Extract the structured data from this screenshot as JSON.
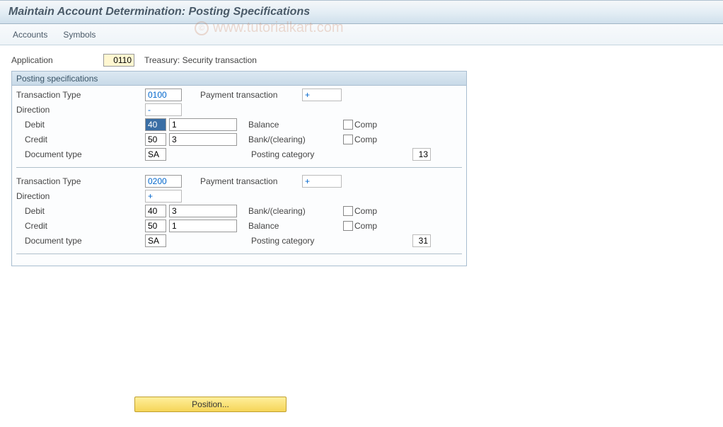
{
  "window": {
    "title": "Maintain Account Determination: Posting Specifications"
  },
  "menu": {
    "accounts": "Accounts",
    "symbols": "Symbols"
  },
  "app": {
    "label": "Application",
    "value": "0110",
    "desc": "Treasury: Security transaction"
  },
  "group": {
    "title": "Posting specifications"
  },
  "labels": {
    "transaction_type": "Transaction Type",
    "direction": "Direction",
    "debit": "Debit",
    "credit": "Credit",
    "document_type": "Document type",
    "payment_transaction": "Payment transaction",
    "balance": "Balance",
    "bank_clearing": "Bank/(clearing)",
    "comp": "Comp",
    "posting_category": "Posting category"
  },
  "block1": {
    "transaction_type": "0100",
    "payment_transaction": "+",
    "direction": "-",
    "debit_key": "40",
    "debit_acc": "1",
    "debit_desc_key": "balance",
    "debit_comp": false,
    "credit_key": "50",
    "credit_acc": "3",
    "credit_desc_key": "bank_clearing",
    "credit_comp": false,
    "document_type": "SA",
    "posting_category": "13"
  },
  "block2": {
    "transaction_type": "0200",
    "payment_transaction": "+",
    "direction": "+",
    "debit_key": "40",
    "debit_acc": "3",
    "debit_desc_key": "bank_clearing",
    "debit_comp": false,
    "credit_key": "50",
    "credit_acc": "1",
    "credit_desc_key": "balance",
    "credit_comp": false,
    "document_type": "SA",
    "posting_category": "31"
  },
  "buttons": {
    "position": "Position..."
  },
  "watermark": "www.tutorialkart.com"
}
